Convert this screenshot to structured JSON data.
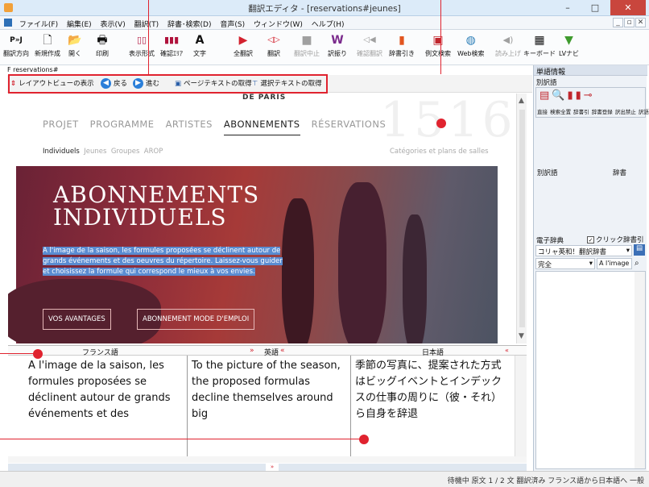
{
  "window": {
    "title": "翻訳エディタ - [reservations#jeunes]",
    "minimize": "–",
    "maximize": "□",
    "close": "✕"
  },
  "menu": {
    "items": [
      "ファイル(F)",
      "編集(E)",
      "表示(V)",
      "翻訳(T)",
      "辞書･検索(D)",
      "音声(S)",
      "ウィンドウ(W)",
      "ヘルプ(H)"
    ],
    "mdi": [
      "_",
      "▫",
      "✕"
    ]
  },
  "toolbar": {
    "items": [
      {
        "icon": "P»J",
        "label": "翻訳方向"
      },
      {
        "icon": "🗋",
        "label": "新規作成"
      },
      {
        "icon": "📂",
        "label": "開く"
      },
      {
        "icon": "🖶",
        "label": "印刷"
      },
      {
        "icon": "▯▯",
        "label": "表示形式"
      },
      {
        "icon": "▮▮▮",
        "label": "確認ｴﾘｱ"
      },
      {
        "icon": "A",
        "label": "文字"
      },
      {
        "icon": "▶",
        "label": "全翻訳"
      },
      {
        "icon": "◁▷",
        "label": "翻訳"
      },
      {
        "icon": "■",
        "label": "翻訳中止"
      },
      {
        "icon": "W",
        "label": "訳振り"
      },
      {
        "icon": "◁◀",
        "label": "確認翻訳"
      },
      {
        "icon": "▮",
        "label": "辞書引き"
      },
      {
        "icon": "▣",
        "label": "例文検索"
      },
      {
        "icon": "◍",
        "label": "Web検索"
      },
      {
        "icon": "◀)",
        "label": "読み上げ"
      },
      {
        "icon": "▦",
        "label": "キーボード"
      },
      {
        "icon": "▼",
        "label": "LVナビ"
      }
    ]
  },
  "document_tab": "F  reservations#",
  "layout_toolbar": {
    "layout_view": "レイアウトビューの表示",
    "back": "戻る",
    "forward": "進む",
    "get_page_text": "ページテキストの取得",
    "get_selected_text": "選択テキストの取得"
  },
  "webpage": {
    "header": "DE PARIS",
    "year": "1516",
    "nav": [
      "PROJET",
      "PROGRAMME",
      "ARTISTES",
      "ABONNEMENTS",
      "RÉSERVATIONS"
    ],
    "active_nav": "ABONNEMENTS",
    "subnav": [
      "Individuels",
      "Jeunes",
      "Groupes",
      "AROP"
    ],
    "categories_link": "Catégories et plans de salles",
    "hero_title_line1": "ABONNEMENTS",
    "hero_title_line2": "INDIVIDUELS",
    "hero_text": "A l'image de la saison, les formules proposées se déclinent autour de grands événements et des oeuvres du répertoire. Laissez-vous guider et choisissez la formule qui correspond le mieux à vos envies.",
    "buttons": [
      "VOS AVANTAGES",
      "ABONNEMENT MODE D'EMPLOI"
    ]
  },
  "columns": {
    "french_header": "フランス語",
    "english_header": "英語",
    "japanese_header": "日本語",
    "french_text": "A l'image de la saison, les formules proposées se déclinent autour de grands événements et des",
    "english_text": "To the picture of the season, the proposed formulas decline themselves around big",
    "japanese_text": "季節の写真に、提案された方式はビッグイベントとインデックスの仕事の周りに（彼・それ）ら自身を辞退"
  },
  "status": "待機中 原文  1 / 2 文  翻訳済み  フランス語から日本語へ  一般",
  "right_panel": {
    "word_info": "単語情報",
    "alt_words": "別訳語",
    "tools": [
      "直接",
      "検索全置",
      "辞書引",
      "辞書登録",
      "訳出禁止",
      "訳語達"
    ],
    "alt_word_col": "別訳語",
    "dict_col": "辞書",
    "e_dict": "電子辞典",
    "click_dict": "クリック辞書引",
    "dict_select": "コリャ英和！翻訳辞書",
    "match": "完全",
    "search_value": "A l'image"
  }
}
